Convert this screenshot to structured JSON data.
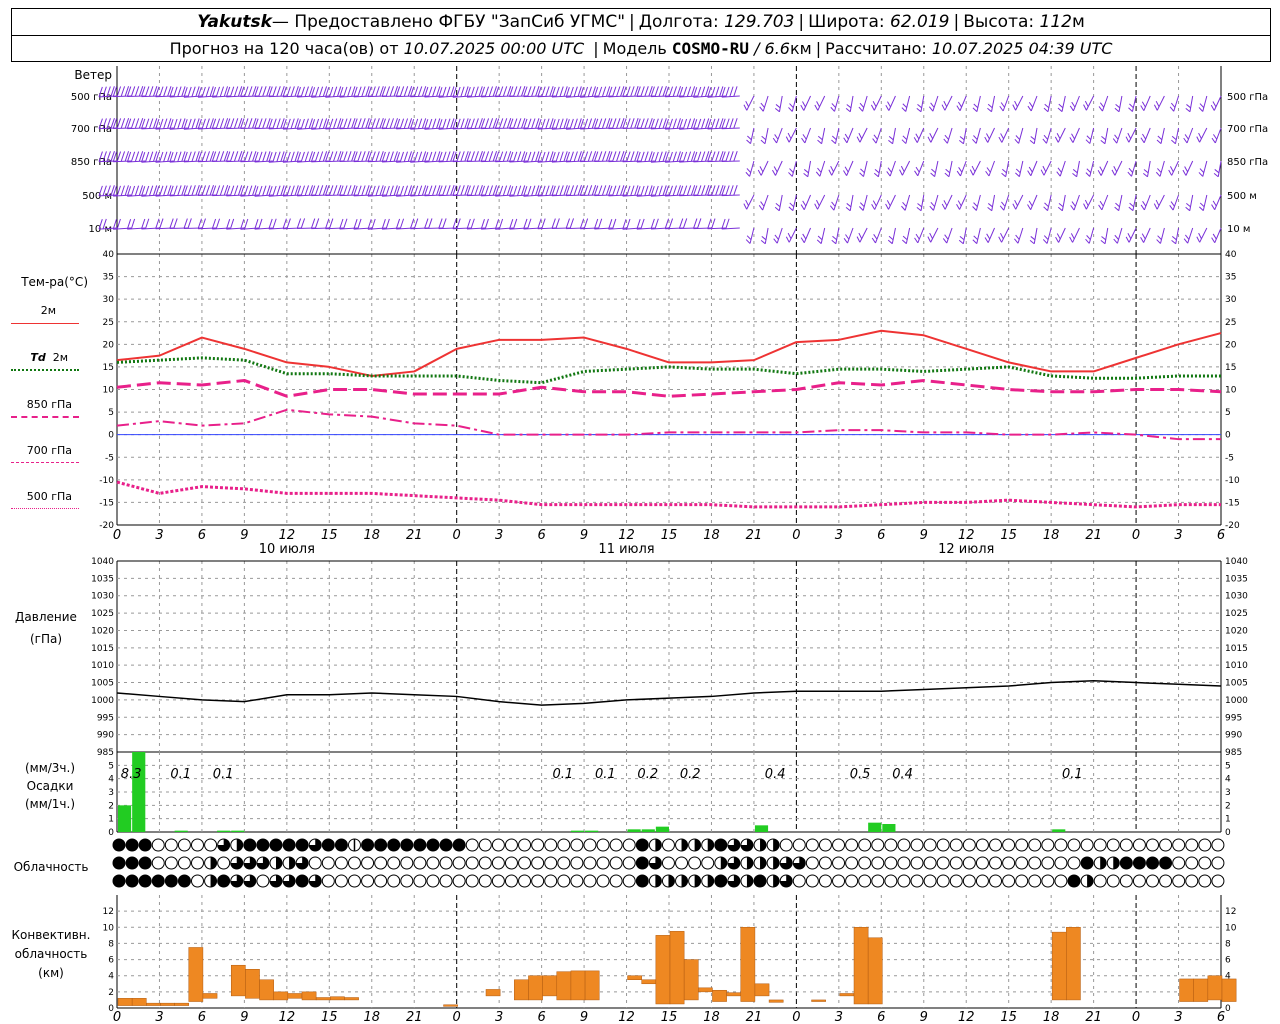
{
  "header": {
    "station": "Yakutsk",
    "provider": " — Предоставлено ФГБУ \"ЗапСиб УГМС\"",
    "lon_label": "Долгота:",
    "lon": "129.703",
    "lat_label": "Широта:",
    "lat": "62.019",
    "alt_label": "Высота:",
    "alt": "112",
    "alt_unit": "м",
    "forecast_label": "Прогноз на 120 часа(ов) от",
    "forecast_time": "10.07.2025 00:00 UTC",
    "model_label": "Модель",
    "model": "COSMO-RU",
    "resolution": "/ 6.6",
    "resolution_unit": "км",
    "calc_label": "Рассчитано:",
    "calc_time": "10.07.2025 04:39 UTC"
  },
  "labels": {
    "wind": "Ветер",
    "temp": "Тем-ра(°C)",
    "pressure": "Давление",
    "pressure_unit": "(гПа)",
    "precip_unit1": "(мм/3ч.)",
    "precip": "Осадки",
    "precip_unit2": "(мм/1ч.)",
    "cloud": "Облачность",
    "conv1": "Конвективн.",
    "conv2": "облачность",
    "conv3": "(км)"
  },
  "legend": {
    "t2m": "2м",
    "td_a": "Td",
    "td_b": "2м",
    "t850": "850 гПа",
    "t700": "700 гПа",
    "t500": "500 гПа"
  },
  "wind_levels": [
    "500 гПа",
    "700 гПа",
    "850 гПа",
    "500  м",
    "10   м"
  ],
  "day_labels": [
    "10 июля",
    "11 июля",
    "12 июля"
  ],
  "hour_ticks": [
    "0",
    "3",
    "6",
    "9",
    "12",
    "15",
    "18",
    "21",
    "0",
    "3",
    "6",
    "9",
    "12",
    "15",
    "18",
    "21",
    "0",
    "3",
    "6",
    "9",
    "12",
    "15",
    "18",
    "21",
    "0",
    "3",
    "6"
  ],
  "colors": {
    "t2m": "#ee3333",
    "td2m": "#117711",
    "t850": "#e8208a",
    "t700": "#e8208a",
    "t500": "#e8208a",
    "wind": "#7a30d8",
    "precip": "#22cc22",
    "conv": "#ee8822",
    "pressure": "#000000"
  },
  "chart_data": [
    {
      "type": "line",
      "title": "Тем-ра(°C)",
      "x_hours": [
        0,
        3,
        6,
        9,
        12,
        15,
        18,
        21,
        24,
        27,
        30,
        33,
        36,
        39,
        42,
        45,
        48,
        51,
        54,
        57,
        60,
        63,
        66,
        69,
        72,
        75,
        78
      ],
      "ylim": [
        -20,
        40
      ],
      "yticks": [
        -20,
        -15,
        -10,
        -5,
        0,
        5,
        10,
        15,
        20,
        25,
        30,
        35,
        40
      ],
      "series": [
        {
          "name": "2м",
          "values": [
            16.5,
            17.5,
            21.5,
            19,
            16,
            15,
            13,
            14,
            19,
            21,
            21,
            21.5,
            19,
            16,
            16,
            16.5,
            20.5,
            21,
            23,
            22,
            19,
            16,
            14,
            14,
            17,
            20,
            22.5
          ]
        },
        {
          "name": "Td 2м",
          "values": [
            16,
            16.5,
            17,
            16.5,
            13.5,
            13.5,
            13,
            13,
            13,
            12,
            11.5,
            14,
            14.5,
            15,
            14.5,
            14.5,
            13.5,
            14.5,
            14.5,
            14,
            14.5,
            15,
            13,
            12.5,
            12.5,
            13,
            13
          ]
        },
        {
          "name": "850 гПа",
          "values": [
            10.5,
            11.5,
            11,
            12,
            8.5,
            10,
            10,
            9,
            9,
            9,
            10.5,
            9.5,
            9.5,
            8.5,
            9,
            9.5,
            10,
            11.5,
            11,
            12,
            11,
            10,
            9.5,
            9.5,
            10,
            10,
            9.5
          ]
        },
        {
          "name": "700 гПа",
          "values": [
            2,
            3,
            2,
            2.5,
            5.5,
            4.5,
            4,
            2.5,
            2,
            0,
            0,
            0,
            0,
            0.5,
            0.5,
            0.5,
            0.5,
            1,
            1,
            0.5,
            0.5,
            0,
            0,
            0.5,
            0,
            -1,
            -1
          ]
        },
        {
          "name": "500 гПа",
          "values": [
            -10.5,
            -13,
            -11.5,
            -12,
            -13,
            -13,
            -13,
            -13.5,
            -14,
            -14.5,
            -15.5,
            -15.5,
            -15.5,
            -15.5,
            -15.5,
            -16,
            -16,
            -16,
            -15.5,
            -15,
            -15,
            -14.5,
            -15,
            -15.5,
            -16,
            -15.5,
            -15.5
          ]
        }
      ]
    },
    {
      "type": "line",
      "title": "Давление",
      "x_hours": [
        0,
        3,
        6,
        9,
        12,
        15,
        18,
        21,
        24,
        27,
        30,
        33,
        36,
        39,
        42,
        45,
        48,
        51,
        54,
        57,
        60,
        63,
        66,
        69,
        72,
        75,
        78
      ],
      "ylim": [
        985,
        1040
      ],
      "yticks": [
        985,
        990,
        995,
        1000,
        1005,
        1010,
        1015,
        1020,
        1025,
        1030,
        1035,
        1040
      ],
      "series": [
        {
          "name": "Давление",
          "values": [
            1002,
            1001,
            1000,
            999.5,
            1001.5,
            1001.5,
            1002,
            1001.5,
            1001,
            999.5,
            998.5,
            999,
            1000,
            1000.5,
            1001,
            1002,
            1002.5,
            1002.5,
            1002.5,
            1003,
            1003.5,
            1004,
            1005,
            1005.5,
            1005,
            1004.5,
            1004
          ]
        }
      ]
    },
    {
      "type": "bar",
      "title": "Осадки",
      "ylim": [
        0,
        6
      ],
      "yticks": [
        0,
        1,
        2,
        3,
        4,
        5
      ],
      "bars_mm_per_hour": [
        {
          "h": 0,
          "v": 2.0
        },
        {
          "h": 1,
          "v": 6.0
        },
        {
          "h": 4,
          "v": 0.1
        },
        {
          "h": 7,
          "v": 0.1
        },
        {
          "h": 8,
          "v": 0.1
        },
        {
          "h": 32,
          "v": 0.1
        },
        {
          "h": 33,
          "v": 0.1
        },
        {
          "h": 36,
          "v": 0.2
        },
        {
          "h": 37,
          "v": 0.2
        },
        {
          "h": 38,
          "v": 0.4
        },
        {
          "h": 45,
          "v": 0.5
        },
        {
          "h": 53,
          "v": 0.7
        },
        {
          "h": 54,
          "v": 0.6
        },
        {
          "h": 66,
          "v": 0.2
        }
      ],
      "totals_3h": [
        {
          "h": 1,
          "label": "8.3"
        },
        {
          "h": 4.5,
          "label": "0.1"
        },
        {
          "h": 7.5,
          "label": "0.1"
        },
        {
          "h": 31.5,
          "label": "0.1"
        },
        {
          "h": 34.5,
          "label": "0.1"
        },
        {
          "h": 37.5,
          "label": "0.2"
        },
        {
          "h": 40.5,
          "label": "0.2"
        },
        {
          "h": 46.5,
          "label": "0.4"
        },
        {
          "h": 52.5,
          "label": "0.5"
        },
        {
          "h": 55.5,
          "label": "0.4"
        },
        {
          "h": 67.5,
          "label": "0.1"
        }
      ]
    },
    {
      "type": "bar",
      "title": "Конвективн. облачность",
      "ylim": [
        0,
        14
      ],
      "yticks": [
        0,
        2,
        4,
        6,
        8,
        10,
        12
      ],
      "bars_km": [
        {
          "h": 0,
          "lo": 0.3,
          "hi": 1.2
        },
        {
          "h": 1,
          "lo": 0.3,
          "hi": 1.2
        },
        {
          "h": 2,
          "lo": 0.3,
          "hi": 0.6
        },
        {
          "h": 3,
          "lo": 0.3,
          "hi": 0.6
        },
        {
          "h": 4,
          "lo": 0.3,
          "hi": 0.6
        },
        {
          "h": 5,
          "lo": 0.8,
          "hi": 7.5
        },
        {
          "h": 6,
          "lo": 1.2,
          "hi": 1.8
        },
        {
          "h": 8,
          "lo": 1.5,
          "hi": 5.3
        },
        {
          "h": 9,
          "lo": 1.2,
          "hi": 4.8
        },
        {
          "h": 10,
          "lo": 1.0,
          "hi": 3.5
        },
        {
          "h": 11,
          "lo": 1.0,
          "hi": 2.0
        },
        {
          "h": 12,
          "lo": 1.2,
          "hi": 1.8
        },
        {
          "h": 13,
          "lo": 1.0,
          "hi": 2.0
        },
        {
          "h": 14,
          "lo": 1.0,
          "hi": 1.3
        },
        {
          "h": 15,
          "lo": 1.0,
          "hi": 1.4
        },
        {
          "h": 16,
          "lo": 1.0,
          "hi": 1.3
        },
        {
          "h": 23,
          "lo": 0.2,
          "hi": 0.4
        },
        {
          "h": 26,
          "lo": 1.5,
          "hi": 2.3
        },
        {
          "h": 28,
          "lo": 1.0,
          "hi": 3.5
        },
        {
          "h": 29,
          "lo": 1.0,
          "hi": 4.0
        },
        {
          "h": 30,
          "lo": 1.5,
          "hi": 4.0
        },
        {
          "h": 31,
          "lo": 1.0,
          "hi": 4.5
        },
        {
          "h": 32,
          "lo": 1.0,
          "hi": 4.6
        },
        {
          "h": 33,
          "lo": 1.0,
          "hi": 4.6
        },
        {
          "h": 36,
          "lo": 3.5,
          "hi": 4.0
        },
        {
          "h": 37,
          "lo": 3.0,
          "hi": 3.5
        },
        {
          "h": 38,
          "lo": 0.5,
          "hi": 9.0
        },
        {
          "h": 39,
          "lo": 0.5,
          "hi": 9.5
        },
        {
          "h": 40,
          "lo": 1.0,
          "hi": 6.0
        },
        {
          "h": 41,
          "lo": 2.0,
          "hi": 2.5
        },
        {
          "h": 42,
          "lo": 0.8,
          "hi": 2.2
        },
        {
          "h": 43,
          "lo": 1.5,
          "hi": 1.9
        },
        {
          "h": 44,
          "lo": 0.8,
          "hi": 10.0
        },
        {
          "h": 45,
          "lo": 1.5,
          "hi": 3.0
        },
        {
          "h": 46,
          "lo": 0.7,
          "hi": 1.0
        },
        {
          "h": 49,
          "lo": 0.8,
          "hi": 1.0
        },
        {
          "h": 51,
          "lo": 1.5,
          "hi": 1.8
        },
        {
          "h": 52,
          "lo": 0.5,
          "hi": 10.0
        },
        {
          "h": 53,
          "lo": 0.5,
          "hi": 8.7
        },
        {
          "h": 66,
          "lo": 1.0,
          "hi": 9.4
        },
        {
          "h": 67,
          "lo": 1.0,
          "hi": 10.0
        },
        {
          "h": 75,
          "lo": 0.8,
          "hi": 3.6
        },
        {
          "h": 76,
          "lo": 0.8,
          "hi": 3.6
        },
        {
          "h": 77,
          "lo": 1.0,
          "hi": 4.0
        },
        {
          "h": 78,
          "lo": 0.8,
          "hi": 3.6
        }
      ]
    }
  ],
  "cloud_rows": [
    "FFFEEEEEDHFFFFFDFFIFFFFFFFFEEEEEEEEEEEEEFHEHHHFDDHHEEEEEEEEEEEEEEEEEEEEEEEEEEEEEEEEEE",
    "FFFEEEEHEDDDHHDEEEEEEEEEEEEEEEEEEEEEEEEEFDEEEEHDHHHDDEEEEEEEEEEEEEEEEEEEEEFHHFFFFEEEE",
    "FFFFFFEHFDDEDDFDEEEEEEEEEEEEEEEEEEEEEEEEFHHHHHFDHFHDEEEEEEEEEEEEEEEEEEEEEFHEEEEEEEEEE"
  ]
}
